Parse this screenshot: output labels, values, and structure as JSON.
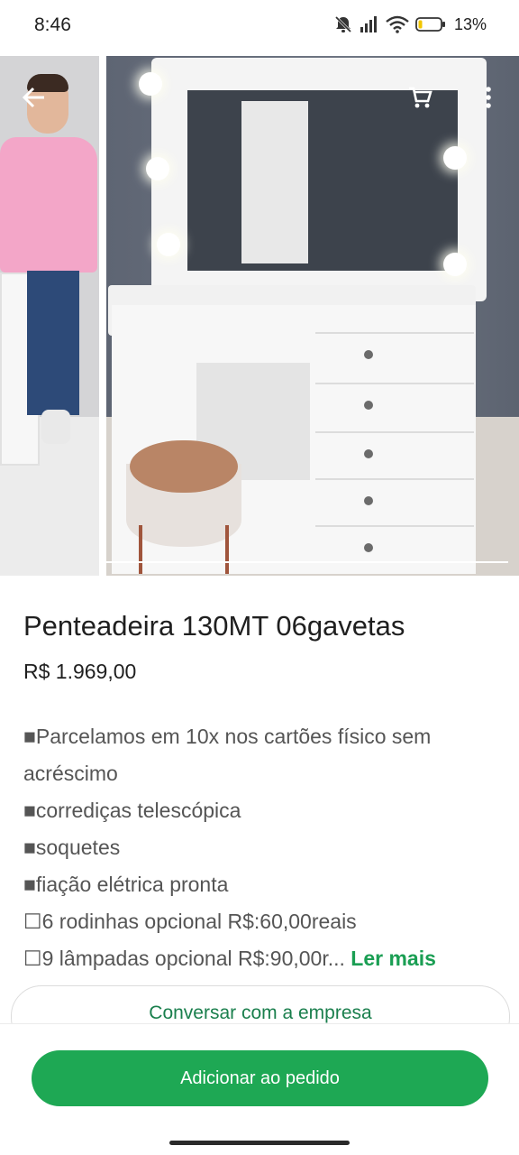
{
  "status_bar": {
    "time": "8:46",
    "battery_percent": "13%",
    "icons": [
      "notifications-off-icon",
      "signal-icon",
      "wifi-icon",
      "battery-icon"
    ]
  },
  "header": {
    "back_icon": "arrow-left-icon",
    "cart_icon": "cart-icon",
    "menu_icon": "more-vertical-icon"
  },
  "product": {
    "title": "Penteadeira 130MT 06gavetas",
    "price": "R$ 1.969,00",
    "description_lines": [
      "■Parcelamos em 10x nos cartões físico sem",
      "acréscimo",
      "■corrediças telescópica",
      "■soquetes",
      "■fiação elétrica pronta",
      "☐6 rodinhas opcional R$:60,00reais",
      "☐9 lâmpadas opcional R$:90,00r..."
    ],
    "read_more": "Ler mais"
  },
  "actions": {
    "chat_label": "Conversar com a empresa",
    "add_label": "Adicionar ao pedido"
  },
  "colors": {
    "accent": "#1ea854",
    "link": "#1a9e53"
  }
}
